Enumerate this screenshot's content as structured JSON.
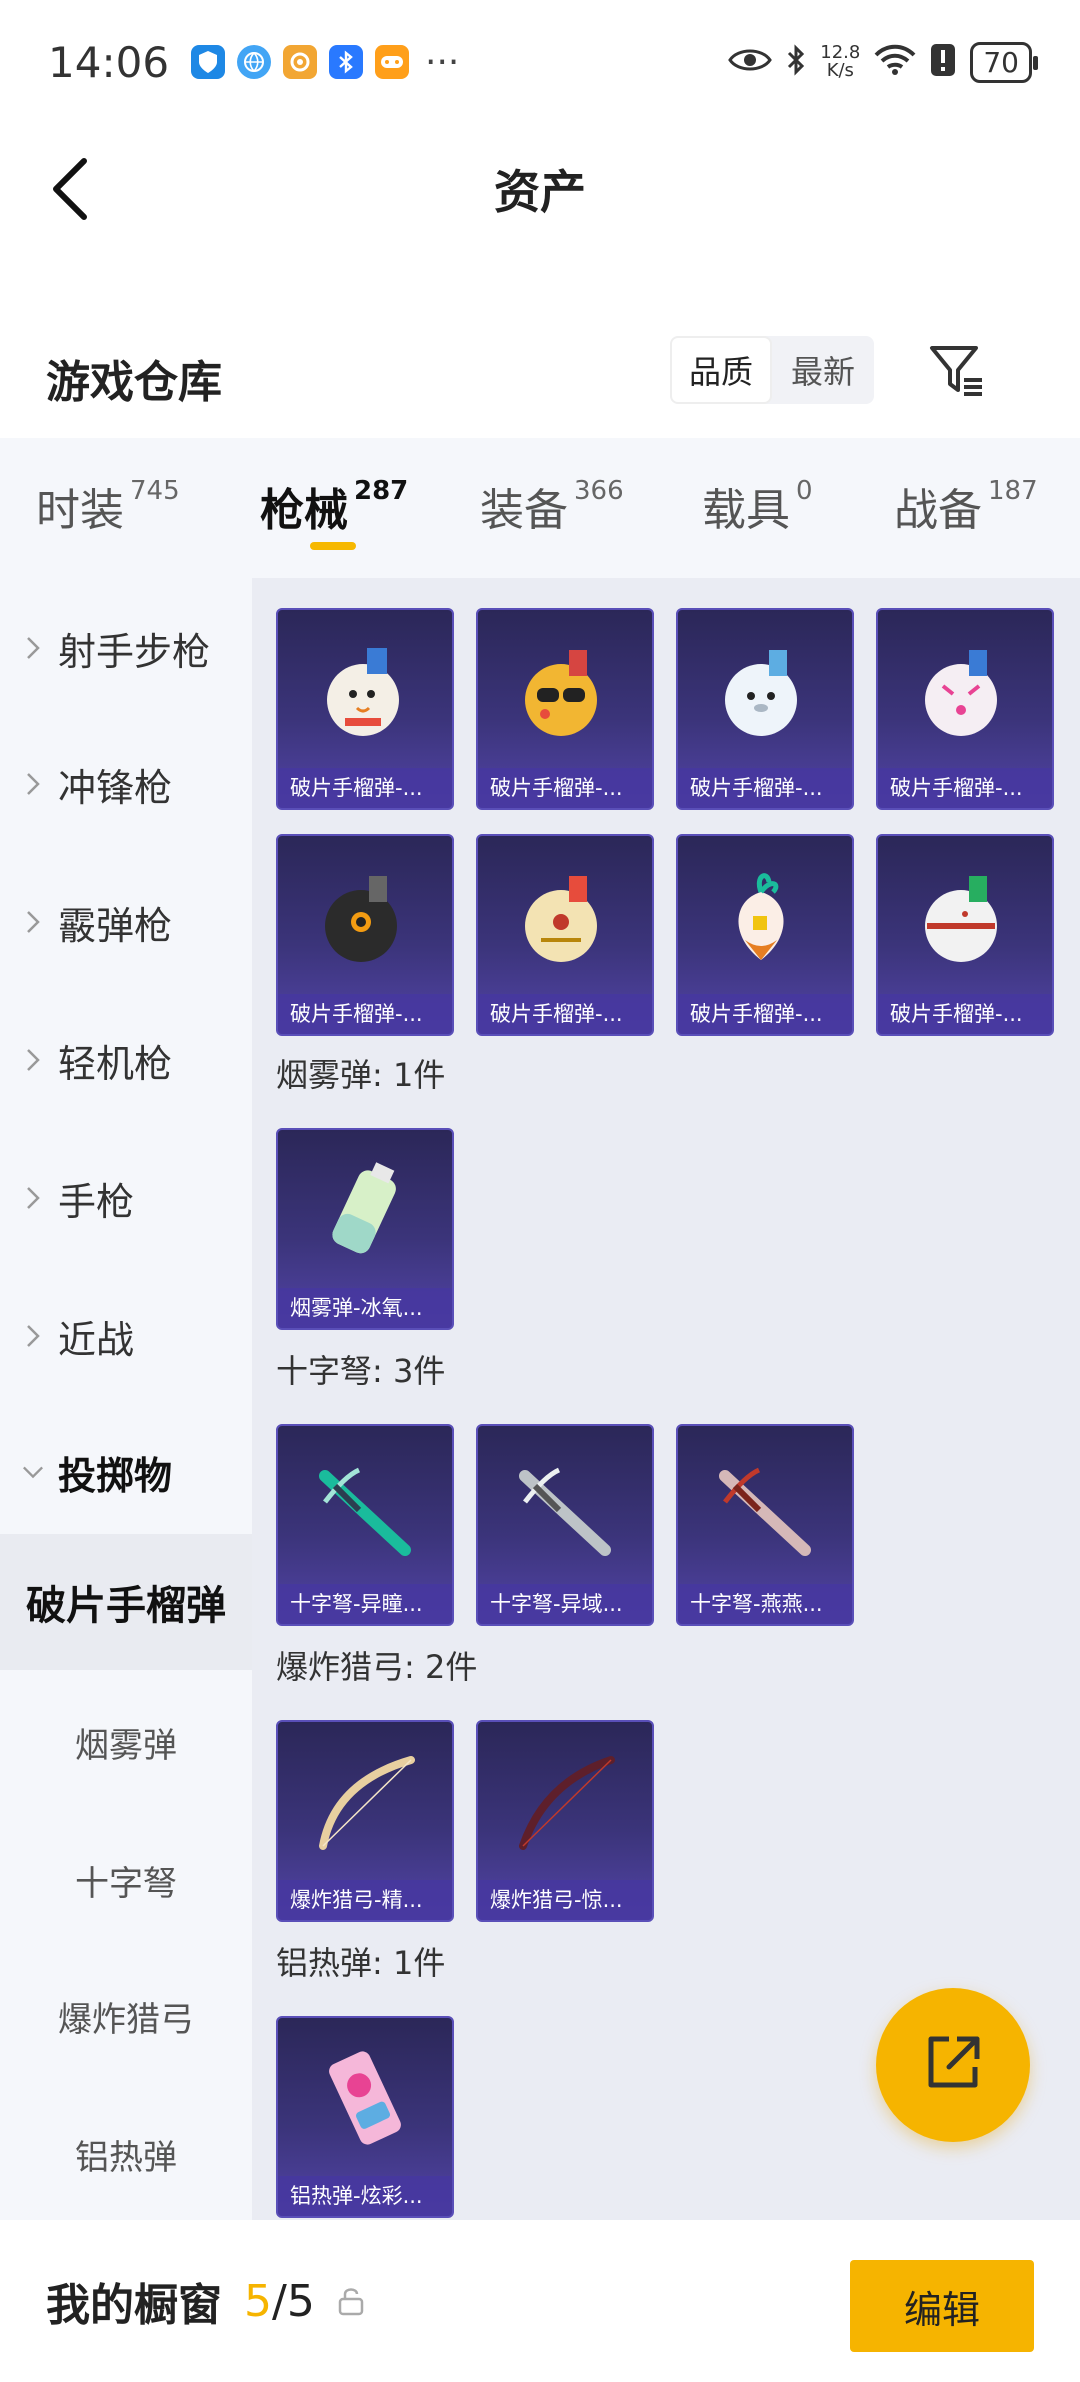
{
  "status_bar": {
    "time": "14:06",
    "apps": [
      {
        "icon": "shield-app-icon",
        "color": "#1e88e5"
      },
      {
        "icon": "browser-app-icon",
        "color": "#42a5f5"
      },
      {
        "icon": "game-app-icon",
        "color": "#f2a633"
      },
      {
        "icon": "bluetooth-app-icon",
        "color": "#2979ff"
      },
      {
        "icon": "gamepad-app-icon",
        "color": "#ff9f1a"
      }
    ],
    "more": "···",
    "net_speed_value": "12.8",
    "net_speed_unit": "K/s",
    "battery": "70"
  },
  "header": {
    "title": "资产"
  },
  "warehouse": {
    "title": "游戏仓库",
    "sort_options": [
      "品质",
      "最新"
    ],
    "sort_selected": "品质"
  },
  "tabs": [
    {
      "label": "时装",
      "count": "745",
      "active": false
    },
    {
      "label": "枪械",
      "count": "287",
      "active": true
    },
    {
      "label": "装备",
      "count": "366",
      "active": false
    },
    {
      "label": "载具",
      "count": "0",
      "active": false
    },
    {
      "label": "战备",
      "count": "187",
      "active": false
    }
  ],
  "sidebar": {
    "items": [
      {
        "label": "射手步枪",
        "type": "collapsed"
      },
      {
        "label": "冲锋枪",
        "type": "collapsed"
      },
      {
        "label": "霰弹枪",
        "type": "collapsed"
      },
      {
        "label": "轻机枪",
        "type": "collapsed"
      },
      {
        "label": "手枪",
        "type": "collapsed"
      },
      {
        "label": "近战",
        "type": "collapsed"
      },
      {
        "label": "投掷物",
        "type": "expanded"
      },
      {
        "label": "破片手榴弹",
        "type": "selected"
      },
      {
        "label": "烟雾弹",
        "type": "sub"
      },
      {
        "label": "十字弩",
        "type": "sub"
      },
      {
        "label": "爆炸猎弓",
        "type": "sub"
      },
      {
        "label": "铝热弹",
        "type": "sub"
      }
    ]
  },
  "content": {
    "grenade_cards": [
      {
        "label": "破片手榴弹-...",
        "art": "snowman-grenade-icon"
      },
      {
        "label": "破片手榴弹-...",
        "art": "sunglasses-grenade-icon"
      },
      {
        "label": "破片手榴弹-...",
        "art": "seal-grenade-icon"
      },
      {
        "label": "破片手榴弹-...",
        "art": "pink-face-grenade-icon"
      },
      {
        "label": "破片手榴弹-...",
        "art": "black-grenade-icon"
      },
      {
        "label": "破片手榴弹-...",
        "art": "cream-grenade-icon"
      },
      {
        "label": "破片手榴弹-...",
        "art": "radish-grenade-icon"
      },
      {
        "label": "破片手榴弹-...",
        "art": "white-grenade-icon"
      }
    ],
    "sections": [
      {
        "title": "烟雾弹: 1件",
        "cards": [
          {
            "label": "烟雾弹-冰氧...",
            "art": "smoke-canister-icon"
          }
        ]
      },
      {
        "title": "十字弩: 3件",
        "cards": [
          {
            "label": "十字弩-异瞳...",
            "art": "teal-crossbow-icon"
          },
          {
            "label": "十字弩-异域...",
            "art": "silver-crossbow-icon"
          },
          {
            "label": "十字弩-燕燕...",
            "art": "red-crossbow-icon"
          }
        ]
      },
      {
        "title": "爆炸猎弓: 2件",
        "cards": [
          {
            "label": "爆炸猎弓-精...",
            "art": "gold-bow-icon"
          },
          {
            "label": "爆炸猎弓-惊...",
            "art": "dark-bow-icon"
          }
        ]
      },
      {
        "title": "铝热弹: 1件",
        "cards": [
          {
            "label": "铝热弹-炫彩...",
            "art": "candy-thermite-icon"
          }
        ]
      }
    ]
  },
  "fab": {
    "icon": "share-external-icon"
  },
  "bottom_bar": {
    "title": "我的橱窗",
    "current": "5",
    "separator_total": "/5",
    "lock_icon": "lock-icon",
    "edit_label": "编辑"
  }
}
